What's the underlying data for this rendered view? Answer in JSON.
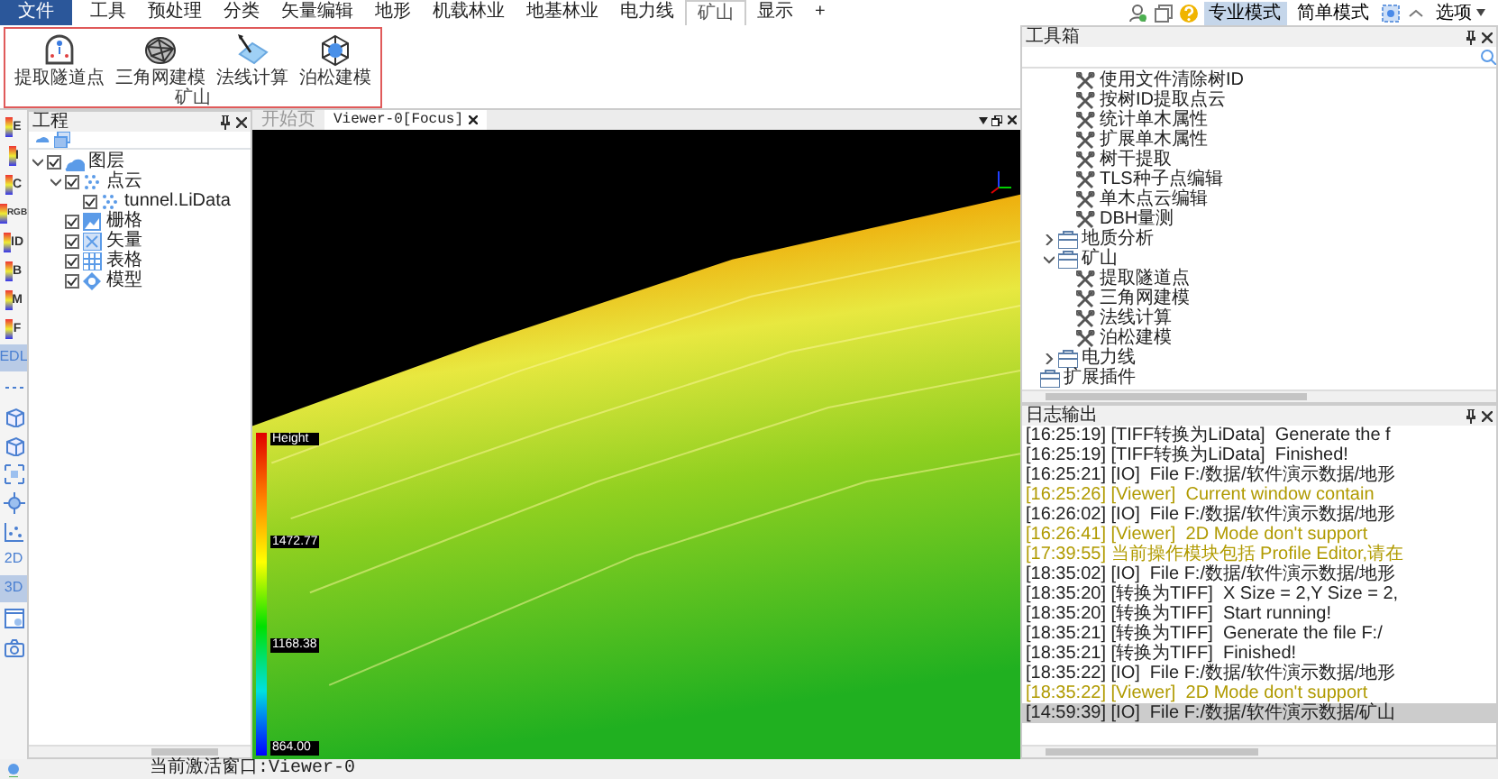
{
  "ribbon": {
    "tabs": [
      {
        "label": "文件",
        "kind": "file",
        "selected": false
      },
      {
        "label": "工具",
        "kind": "tab",
        "selected": false
      },
      {
        "label": "预处理",
        "kind": "tab",
        "selected": false
      },
      {
        "label": "分类",
        "kind": "tab",
        "selected": false
      },
      {
        "label": "矢量编辑",
        "kind": "tab",
        "selected": false
      },
      {
        "label": "地形",
        "kind": "tab",
        "selected": false
      },
      {
        "label": "机载林业",
        "kind": "tab",
        "selected": false
      },
      {
        "label": "地基林业",
        "kind": "tab",
        "selected": false
      },
      {
        "label": "电力线",
        "kind": "tab",
        "selected": false
      },
      {
        "label": "矿山",
        "kind": "tab",
        "selected": true
      },
      {
        "label": "显示",
        "kind": "tab",
        "selected": false
      },
      {
        "label": "+",
        "kind": "tab",
        "selected": false
      }
    ],
    "right_controls": [
      {
        "kind": "user"
      },
      {
        "kind": "windows"
      },
      {
        "kind": "help"
      },
      {
        "kind": "mode",
        "label": "专业模式",
        "selected": true
      },
      {
        "kind": "mode",
        "label": "简单模式",
        "selected": false
      },
      {
        "kind": "layout"
      },
      {
        "kind": "collapse"
      },
      {
        "kind": "menu",
        "label": "选项"
      }
    ],
    "group": {
      "label": "矿山",
      "buttons": [
        {
          "label": "提取隧道点",
          "kind": "tunnel"
        },
        {
          "label": "三角网建模",
          "kind": "mesh"
        },
        {
          "label": "法线计算",
          "kind": "normal"
        },
        {
          "label": "泊松建模",
          "kind": "poisson"
        }
      ]
    }
  },
  "left_toolbar": [
    {
      "kind": "ramp",
      "label": "E",
      "selected": false
    },
    {
      "kind": "ramp",
      "label": "I",
      "selected": false
    },
    {
      "kind": "ramp",
      "label": "C",
      "selected": false
    },
    {
      "kind": "ramp",
      "label": "RGB",
      "selected": false
    },
    {
      "kind": "ramp",
      "label": "ID",
      "selected": false
    },
    {
      "kind": "ramp",
      "label": "B",
      "selected": false
    },
    {
      "kind": "ramp",
      "label": "M",
      "selected": false
    },
    {
      "kind": "ramp",
      "label": "F",
      "selected": false
    },
    {
      "kind": "text",
      "label": "EDL",
      "selected": true
    },
    {
      "kind": "dots",
      "selected": false
    },
    {
      "kind": "cube",
      "selected": false
    },
    {
      "kind": "cube",
      "selected": false
    },
    {
      "kind": "fit",
      "selected": false
    },
    {
      "kind": "move",
      "selected": false
    },
    {
      "kind": "chart",
      "selected": false
    },
    {
      "kind": "text",
      "label": "2D",
      "selected": false
    },
    {
      "kind": "text",
      "label": "3D",
      "selected": true
    },
    {
      "kind": "window",
      "selected": false
    },
    {
      "kind": "camera",
      "selected": false
    }
  ],
  "project": {
    "title": "工程",
    "tree": [
      {
        "label": "图层",
        "kind": "layers",
        "expanded": true,
        "checked": true,
        "children": [
          {
            "label": "点云",
            "kind": "pointcloud",
            "expanded": true,
            "checked": true,
            "children": [
              {
                "label": "tunnel.LiData",
                "kind": "pointcloud",
                "checked": true
              }
            ]
          },
          {
            "label": "栅格",
            "kind": "raster",
            "checked": true
          },
          {
            "label": "矢量",
            "kind": "vector",
            "checked": true
          },
          {
            "label": "表格",
            "kind": "table",
            "checked": true
          },
          {
            "label": "模型",
            "kind": "model",
            "checked": true
          }
        ]
      }
    ]
  },
  "viewer": {
    "tabs": [
      {
        "label": "开始页",
        "selected": false,
        "closable": false
      },
      {
        "label": "Viewer-0[Focus]",
        "selected": true,
        "closable": true
      }
    ],
    "legend": {
      "title": "Height",
      "labels": [
        "1472.77",
        "1168.38",
        "864.00"
      ]
    }
  },
  "toolbox": {
    "title": "工具箱",
    "tree": [
      {
        "children": [
          {
            "children": [
              {
                "label": "使用文件清除树ID",
                "kind": "tool"
              },
              {
                "label": "按树ID提取点云",
                "kind": "tool"
              },
              {
                "label": "统计单木属性",
                "kind": "tool"
              },
              {
                "label": "扩展单木属性",
                "kind": "tool"
              },
              {
                "label": "树干提取",
                "kind": "tool"
              },
              {
                "label": "TLS种子点编辑",
                "kind": "tool"
              },
              {
                "label": "单木点云编辑",
                "kind": "tool"
              },
              {
                "label": "DBH量测",
                "kind": "tool"
              }
            ]
          },
          {
            "label": "地质分析",
            "kind": "folder",
            "expanded": false
          },
          {
            "label": "矿山",
            "kind": "folder",
            "expanded": true,
            "children": [
              {
                "label": "提取隧道点",
                "kind": "tool"
              },
              {
                "label": "三角网建模",
                "kind": "tool"
              },
              {
                "label": "法线计算",
                "kind": "tool"
              },
              {
                "label": "泊松建模",
                "kind": "tool"
              }
            ]
          },
          {
            "label": "电力线",
            "kind": "folder",
            "expanded": false
          }
        ]
      },
      {
        "label": "扩展插件",
        "kind": "folder"
      }
    ]
  },
  "log": {
    "title": "日志输出",
    "lines": [
      {
        "text": "[16:25:19] [TIFF转换为LiData]  Generate the f",
        "kind": "info",
        "selected": false
      },
      {
        "text": "[16:25:19] [TIFF转换为LiData]  Finished!",
        "kind": "info",
        "selected": false
      },
      {
        "text": "[16:25:21] [IO]  File F:/数据/软件演示数据/地形",
        "kind": "info",
        "selected": false
      },
      {
        "text": "[16:25:26] [Viewer]  Current window contain",
        "kind": "warning",
        "selected": false
      },
      {
        "text": "[16:26:02] [IO]  File F:/数据/软件演示数据/地形",
        "kind": "info",
        "selected": false
      },
      {
        "text": "[16:26:41] [Viewer]  2D Mode don't support",
        "kind": "warning",
        "selected": false
      },
      {
        "text": "[17:39:55] 当前操作模块包括 Profile Editor,请在",
        "kind": "warning",
        "selected": false
      },
      {
        "text": "[18:35:02] [IO]  File F:/数据/软件演示数据/地形",
        "kind": "info",
        "selected": false
      },
      {
        "text": "[18:35:20] [转换为TIFF]  X Size = 2,Y Size = 2,",
        "kind": "info",
        "selected": false
      },
      {
        "text": "[18:35:20] [转换为TIFF]  Start running!",
        "kind": "info",
        "selected": false
      },
      {
        "text": "[18:35:21] [转换为TIFF]  Generate the file F:/",
        "kind": "info",
        "selected": false
      },
      {
        "text": "[18:35:21] [转换为TIFF]  Finished!",
        "kind": "info",
        "selected": false
      },
      {
        "text": "[18:35:22] [IO]  File F:/数据/软件演示数据/地形",
        "kind": "info",
        "selected": false
      },
      {
        "text": "[18:35:22] [Viewer]  2D Mode don't support",
        "kind": "warning",
        "selected": false
      },
      {
        "text": "[14:59:39] [IO]  File F:/数据/软件演示数据/矿山",
        "kind": "info",
        "selected": true
      }
    ]
  },
  "status_bar": {
    "text": "当前激活窗口:Viewer-0"
  }
}
